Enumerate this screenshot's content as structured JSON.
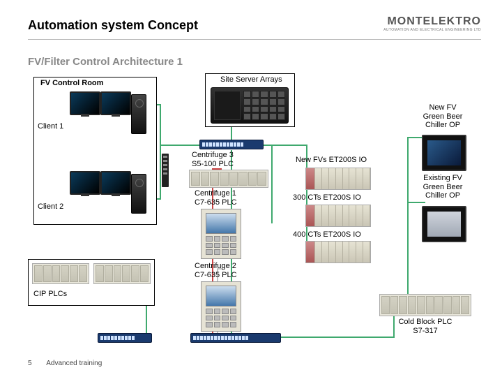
{
  "header": {
    "title": "Automation system Concept",
    "subtitle": "FV/Filter Control Architecture 1",
    "logo_main": "MONTELEKTRO",
    "logo_sub": "AUTOMATION AND ELECTRICAL ENGINEERING LTD"
  },
  "footer": {
    "page_number": "5",
    "text": "Advanced training"
  },
  "diagram": {
    "fv_control_room": "FV Control Room",
    "client1": "Client 1",
    "client2": "Client 2",
    "site_server_arrays": "Site Server Arrays",
    "centrifuge3": "Centrifuge 3\nS5-100 PLC",
    "centrifuge1": "Centrifuge 1\nC7-635 PLC",
    "centrifuge2": "Centrifuge 2\nC7-635 PLC",
    "new_fvs_io": "New FVs ET200S IO",
    "cts300_io": "300 CTs ET200S IO",
    "cts400_io": "400 CTs ET200S IO",
    "new_fv_chiller": "New FV\nGreen Beer\nChiller OP",
    "existing_fv_chiller": "Existing FV\nGreen Beer\nChiller OP",
    "cold_block_plc": "Cold Block PLC\nS7-317",
    "cip_plcs": "CIP PLCs"
  }
}
